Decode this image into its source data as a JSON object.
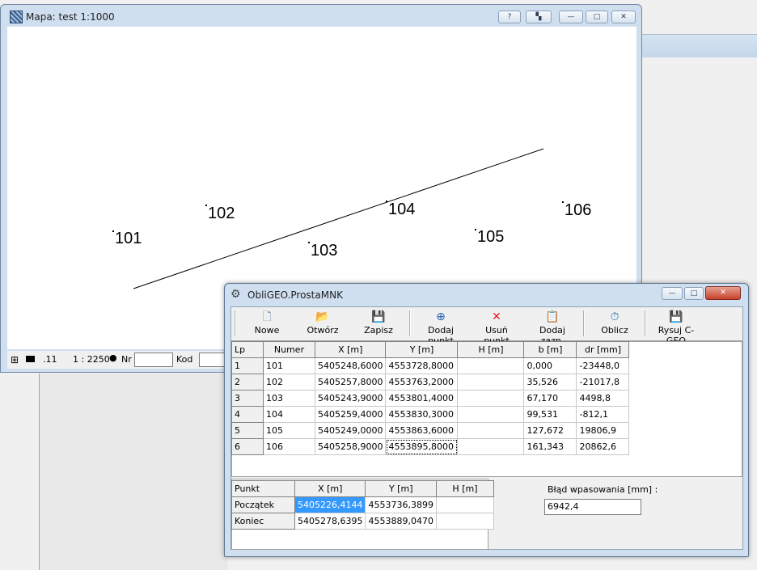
{
  "map_window": {
    "title": "Mapa: test  1:1000",
    "title_buttons": [
      "?",
      "",
      "—",
      "□",
      "✕"
    ],
    "points": [
      {
        "label": "101"
      },
      {
        "label": "102"
      },
      {
        "label": "103"
      },
      {
        "label": "104"
      },
      {
        "label": "105"
      },
      {
        "label": "106"
      }
    ],
    "status": {
      "point_size": ".11",
      "scale": "1 : 2250",
      "nr_label": "Nr",
      "nr_value": "",
      "kod_label": "Kod",
      "kod_value": ""
    }
  },
  "dialog": {
    "title": "ObliGEO.ProstaMNK",
    "toolbar": {
      "nowe": "Nowe",
      "otworz": "Otwórz",
      "zapisz": "Zapisz",
      "dodaj_punkt": "Dodaj punkt",
      "usun_punkt": "Usuń punkt",
      "dodaj_zazn": "Dodaj zazn.",
      "oblicz": "Oblicz",
      "rysuj": "Rysuj C-GEO"
    },
    "points_table": {
      "headers": [
        "Lp",
        "Numer",
        "X [m]",
        "Y [m]",
        "H [m]",
        "b [m]",
        "dr [mm]"
      ],
      "rows": [
        [
          "1",
          "101",
          "5405248,6000",
          "4553728,8000",
          "",
          "0,000",
          "-23448,0"
        ],
        [
          "2",
          "102",
          "5405257,8000",
          "4553763,2000",
          "",
          "35,526",
          "-21017,8"
        ],
        [
          "3",
          "103",
          "5405243,9000",
          "4553801,4000",
          "",
          "67,170",
          "4498,8"
        ],
        [
          "4",
          "104",
          "5405259,4000",
          "4553830,3000",
          "",
          "99,531",
          "-812,1"
        ],
        [
          "5",
          "105",
          "5405249,0000",
          "4553863,6000",
          "",
          "127,672",
          "19806,9"
        ],
        [
          "6",
          "106",
          "5405258,9000",
          "4553895,8000",
          "",
          "161,343",
          "20862,6"
        ]
      ]
    },
    "result_table": {
      "headers": [
        "Punkt",
        "X [m]",
        "Y [m]",
        "H [m]"
      ],
      "rows": [
        [
          "Początek",
          "5405226,4144",
          "4553736,3899",
          ""
        ],
        [
          "Koniec",
          "5405278,6395",
          "4553889,0470",
          ""
        ]
      ]
    },
    "fit_error": {
      "label": "Błąd wpasowania [mm] :",
      "value": "6942,4"
    }
  }
}
